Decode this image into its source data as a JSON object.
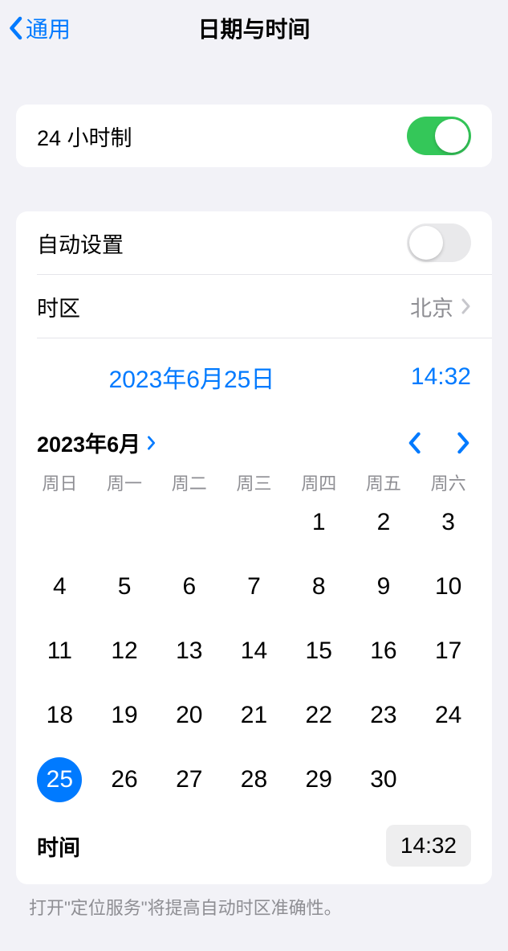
{
  "nav": {
    "back_label": "通用",
    "title": "日期与时间"
  },
  "twentyFourHour": {
    "label": "24 小时制",
    "enabled": true
  },
  "autoSet": {
    "label": "自动设置",
    "enabled": false
  },
  "timezone": {
    "label": "时区",
    "value": "北京"
  },
  "selectedDateTime": {
    "date": "2023年6月25日",
    "time": "14:32"
  },
  "calendar": {
    "month_label": "2023年6月",
    "weekdays": [
      "周日",
      "周一",
      "周二",
      "周三",
      "周四",
      "周五",
      "周六"
    ],
    "first_day_column": 4,
    "days_in_month": 30,
    "selected_day": 25
  },
  "timeRow": {
    "label": "时间",
    "value": "14:32"
  },
  "footer": "打开\"定位服务\"将提高自动时区准确性。"
}
